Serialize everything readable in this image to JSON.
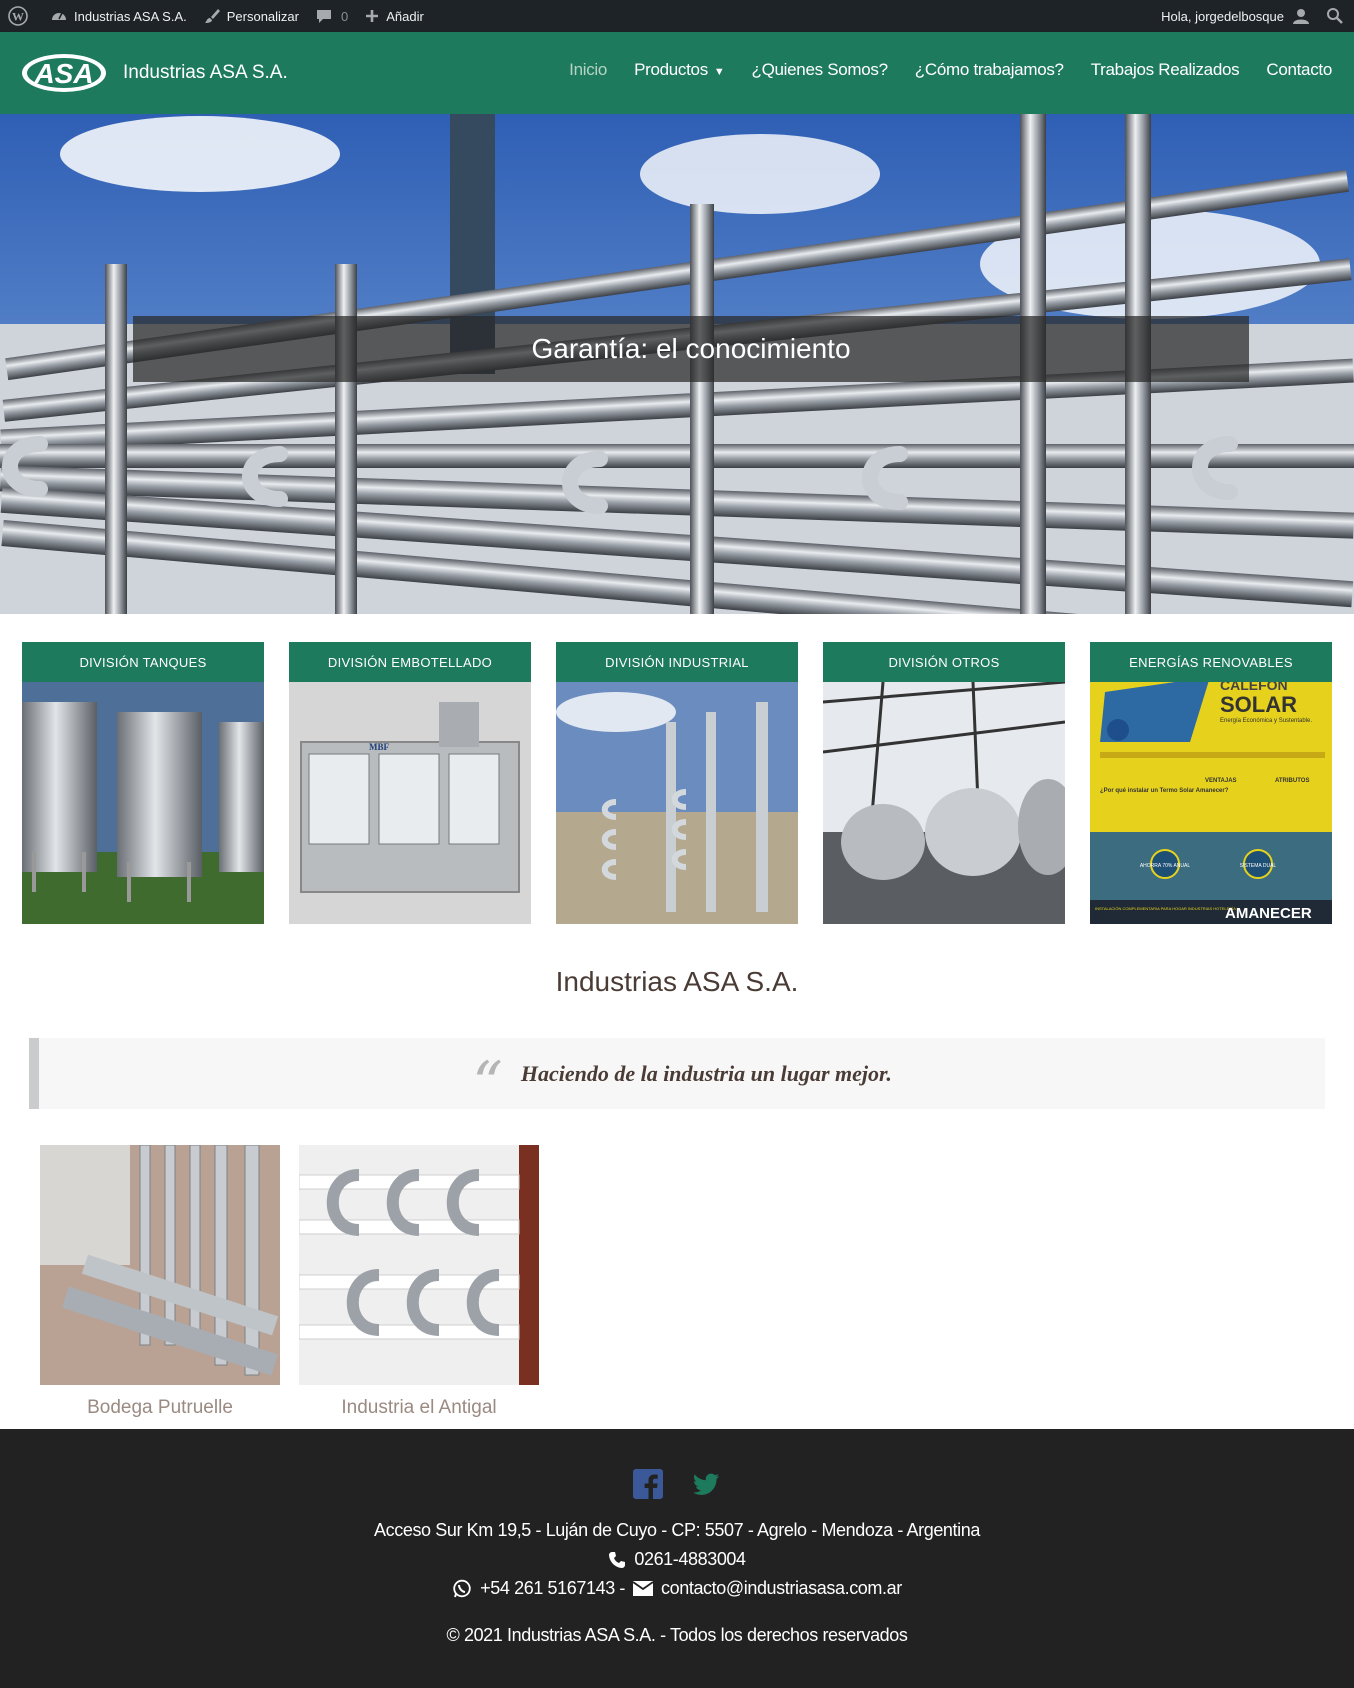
{
  "adminbar": {
    "site_name": "Industrias ASA S.A.",
    "customize": "Personalizar",
    "comments_count": "0",
    "add_new": "Añadir",
    "greeting": "Hola, jorgedelbosque"
  },
  "header": {
    "logo_text": "ASA",
    "site_title": "Industrias ASA S.A.",
    "nav": [
      "Inicio",
      "Productos",
      "¿Quienes Somos?",
      "¿Cómo trabajamos?",
      "Trabajos Realizados",
      "Contacto"
    ],
    "productos_caret": "▼"
  },
  "hero": {
    "caption": "Garantía: el conocimiento"
  },
  "divisions": [
    {
      "title": "DIVISIÓN TANQUES"
    },
    {
      "title": "DIVISIÓN EMBOTELLADO",
      "image_text": "MBF"
    },
    {
      "title": "DIVISIÓN INDUSTRIAL"
    },
    {
      "title": "DIVISIÓN OTROS"
    },
    {
      "title": "ENERGÍAS RENOVABLES",
      "image_text": [
        "CALEFÓN",
        "SOLAR",
        "Energía Económica y Sustentable.",
        "AMANECER",
        "¿Por qué instalar un Termo Solar Amanecer?",
        "VENTAJAS",
        "ATRIBUTOS",
        "AHORRA 70% ANUAL",
        "SISTEMA DUAL",
        "INSTALACIÓN COMPLEMENTARIA PARA HOGAR INDUSTRIAS HOTELERÍA"
      ]
    }
  ],
  "section_title": "Industrias ASA S.A.",
  "quote": {
    "mark": "“",
    "text": "Haciendo de la industria un lugar mejor."
  },
  "works": [
    {
      "caption": "Bodega Putruelle"
    },
    {
      "caption": "Industria el Antigal"
    }
  ],
  "footer": {
    "address": "Acceso Sur Km 19,5 - Luján de Cuyo - CP: 5507 - Agrelo - Mendoza - Argentina",
    "phone": "0261-4883004",
    "whatsapp": "+54 261 5167143 -",
    "email": "contacto@industriasasa.com.ar",
    "copyright": "© 2021 Industrias ASA S.A. - Todos los derechos reservados"
  },
  "colors": {
    "brand_green": "#1e7a5c",
    "admin_bar": "#1d2327",
    "footer_bg": "#222222",
    "facebook": "#3b5998",
    "twitter": "#1e7a5c"
  },
  "icons": [
    "wordpress-icon",
    "dashboard-icon",
    "brush-icon",
    "comment-icon",
    "plus-icon",
    "user-icon",
    "search-icon",
    "facebook-icon",
    "twitter-icon",
    "phone-icon",
    "whatsapp-icon",
    "envelope-icon"
  ]
}
